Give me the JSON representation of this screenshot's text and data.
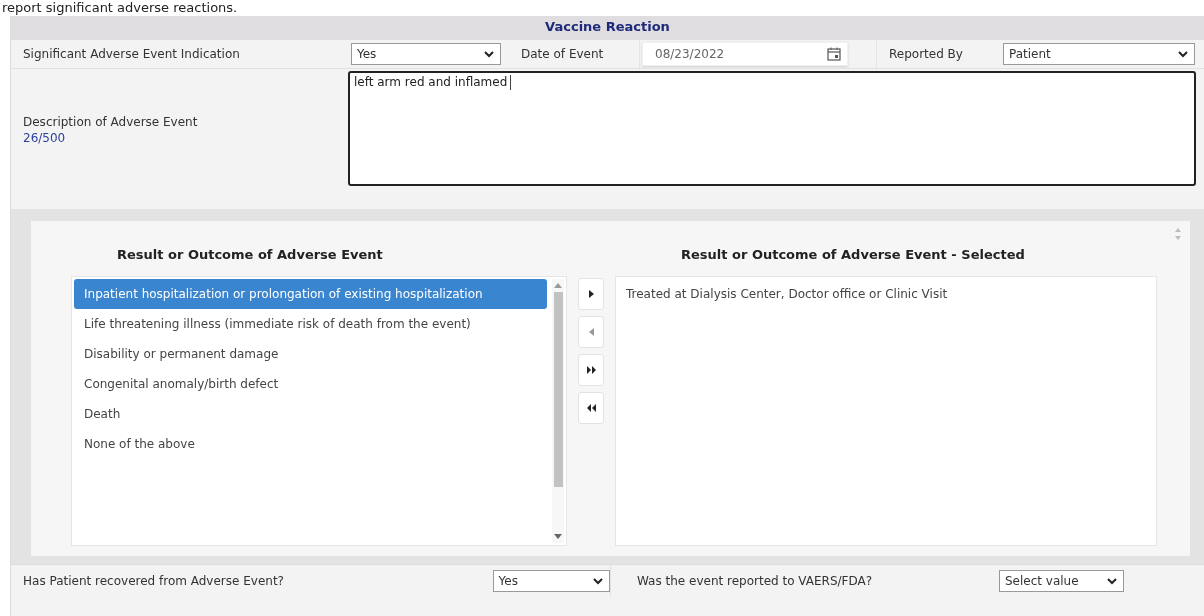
{
  "intro_text": "report significant adverse reactions.",
  "section": {
    "title": "Vaccine Reaction"
  },
  "fields_row": [
    {
      "kind": "select",
      "label": "Significant Adverse Event Indication",
      "value": "Yes"
    },
    {
      "kind": "date",
      "label": "Date of Event",
      "value": "08/23/2022"
    },
    {
      "kind": "select",
      "label": "Reported By",
      "value": "Patient"
    }
  ],
  "description": {
    "label": "Description of Adverse Event",
    "count": "26/500",
    "value": "left arm red and inflamed"
  },
  "outcome": {
    "available_title": "Result or Outcome of Adverse Event",
    "available": [
      {
        "label": "Inpatient hospitalization or prolongation of existing hospitalization",
        "selected": true
      },
      {
        "label": "Life threatening illness (immediate risk of death from the event)",
        "selected": false
      },
      {
        "label": "Disability or permanent damage",
        "selected": false
      },
      {
        "label": "Congenital anomaly/birth defect",
        "selected": false
      },
      {
        "label": "Death",
        "selected": false
      },
      {
        "label": "None of the above",
        "selected": false
      }
    ],
    "selected_title": "Result or Outcome of Adverse Event - Selected",
    "selected_items": [
      "Treated at Dialysis Center, Doctor office or Clinic Visit"
    ]
  },
  "bottom_fields": [
    {
      "label": "Has Patient recovered from Adverse Event?",
      "value": "Yes"
    },
    {
      "label": "Was the event reported to VAERS/FDA?",
      "value": "Select value"
    }
  ]
}
